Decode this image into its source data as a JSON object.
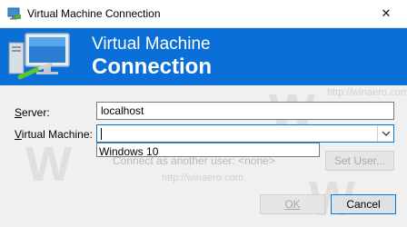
{
  "window": {
    "title": "Virtual Machine Connection",
    "close_glyph": "✕"
  },
  "banner": {
    "line1": "Virtual Machine",
    "line2": "Connection",
    "color": "#0a6fd6",
    "icon": "computer-network-icon"
  },
  "form": {
    "server_label": "Server:",
    "server_value": "localhost",
    "vm_label": "Virtual Machine:",
    "vm_value": "",
    "vm_options": [
      "Windows 10"
    ],
    "connect_as_text": "Connect as another user: <none>",
    "set_user_button": "Set User..."
  },
  "footer": {
    "ok_button": "OK",
    "cancel_button": "Cancel"
  },
  "watermark": {
    "text": "http://winaero.com"
  }
}
